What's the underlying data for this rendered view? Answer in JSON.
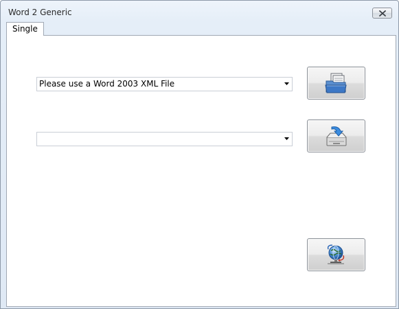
{
  "window": {
    "title": "Word 2 Generic"
  },
  "tabs": [
    {
      "label": "Single",
      "selected": true
    }
  ],
  "input_combo": {
    "value": "Please use a Word 2003 XML File"
  },
  "output_combo": {
    "value": ""
  },
  "icons": {
    "close": "close-icon",
    "open": "folder-open-icon",
    "save": "save-icon",
    "run": "globe-network-icon"
  }
}
